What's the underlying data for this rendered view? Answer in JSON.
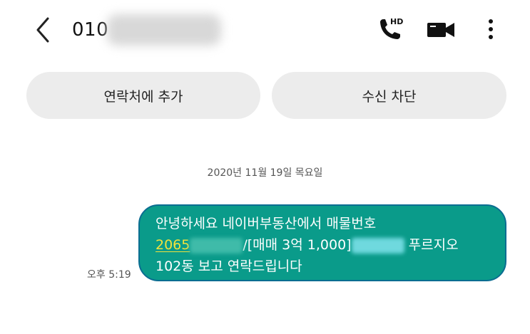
{
  "header": {
    "back_icon": "chevron-left-icon",
    "phone_prefix": "010",
    "actions": [
      {
        "icon": "hd-voice-call-icon",
        "badge": "HD"
      },
      {
        "icon": "video-call-icon"
      },
      {
        "icon": "more-vertical-icon"
      }
    ]
  },
  "buttons": {
    "add_contact": "연락처에 추가",
    "block": "수신 차단"
  },
  "date_divider": "2020년 11월 19일 목요일",
  "message": {
    "time": "오후 5:19",
    "line1": "안녕하세요 네이버부동산에서 매물번호",
    "link_number": "2065",
    "line2_mid": "/[매매 3억 1,000]",
    "line2_end": "푸르지오",
    "line3": "102동 보고 연락드립니다"
  },
  "colors": {
    "bubble_bg": "#0a9b8a",
    "bubble_border": "#0a6d91",
    "link": "#f2e23c",
    "pill_bg": "#ececec"
  }
}
